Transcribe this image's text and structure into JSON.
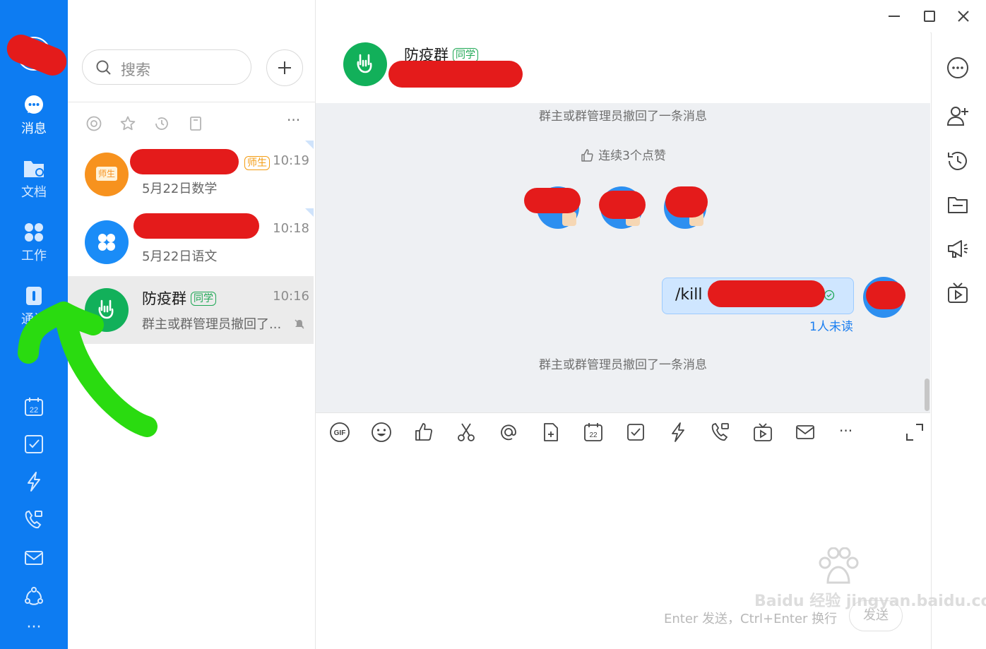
{
  "sidebar": {
    "items": [
      {
        "label": "消息",
        "icon": "message-icon"
      },
      {
        "label": "文档",
        "icon": "folder-icon"
      },
      {
        "label": "工作",
        "icon": "apps-icon"
      },
      {
        "label": "通讯",
        "icon": "contacts-icon"
      }
    ],
    "tools": [
      "calendar-icon",
      "checkbox-icon",
      "bolt-icon",
      "video-call-icon",
      "mail-icon",
      "network-icon",
      "more-icon"
    ],
    "calendar_day": "22",
    "more": "···"
  },
  "search": {
    "placeholder": "搜索"
  },
  "conversations": [
    {
      "name": "",
      "tag": "师生",
      "time": "10:19",
      "preview": "5月22日数学",
      "avatar_label": "师生",
      "avatar_color": "#f7921e"
    },
    {
      "name": "",
      "tag": "",
      "time": "10:18",
      "preview": "5月22日语文",
      "avatar_color": "#1a8cf7"
    },
    {
      "name": "防疫群",
      "tag": "同学",
      "time": "10:16",
      "preview": "群主或群管理员撤回了...",
      "avatar_color": "#12b05a"
    }
  ],
  "chat": {
    "title": "防疫群",
    "title_tag": "同学",
    "system_messages": [
      "群主或群管理员撤回了一条消息",
      "群主或群管理员撤回了一条消息"
    ],
    "like_notice": "连续3个点赞",
    "message": {
      "text": "/kill",
      "read_status": "1人未读"
    },
    "input_hint": "Enter 发送，Ctrl+Enter 换行",
    "send_label": "发送"
  },
  "toolbar": {
    "gif_label": "GIF",
    "calendar_day": "22",
    "more": "···"
  },
  "colors": {
    "nav_blue": "#0d7cf2",
    "group_green": "#12b05a",
    "bubble_blue": "#cfe6ff",
    "redaction_red": "#e41b1b",
    "annotation_green": "#2adb10"
  },
  "watermark": "Baidu 经验 jingyan.baidu.com"
}
